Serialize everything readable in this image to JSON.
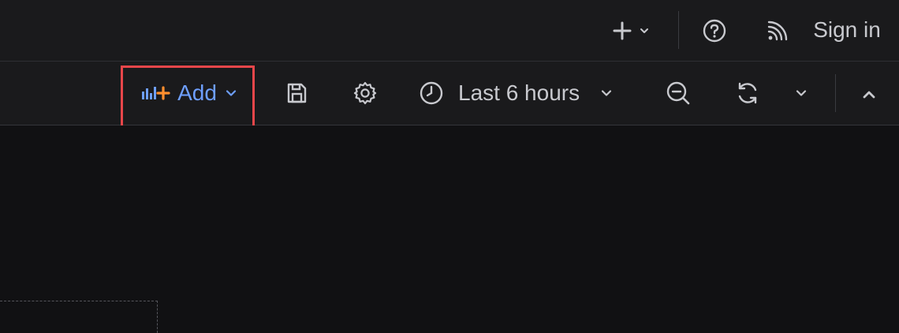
{
  "topbar": {
    "new_icon": "plus-icon",
    "help_icon": "question-circle-icon",
    "news_icon": "rss-icon",
    "sign_in_label": "Sign in"
  },
  "toolbar": {
    "add_label": "Add",
    "add_icon": "add-panel-icon",
    "save_icon": "save-icon",
    "settings_icon": "cog-icon",
    "time_range_label": "Last 6 hours",
    "zoom_out_icon": "zoom-out-icon",
    "refresh_icon": "sync-icon",
    "collapse_icon": "angle-up-icon"
  },
  "colors": {
    "accent_blue": "#6e9fff",
    "accent_orange": "#ff8f2e",
    "highlight_red": "#e8464a",
    "text": "#c8c9ce",
    "panel_bg": "#1a1a1c",
    "canvas_bg": "#111113"
  }
}
